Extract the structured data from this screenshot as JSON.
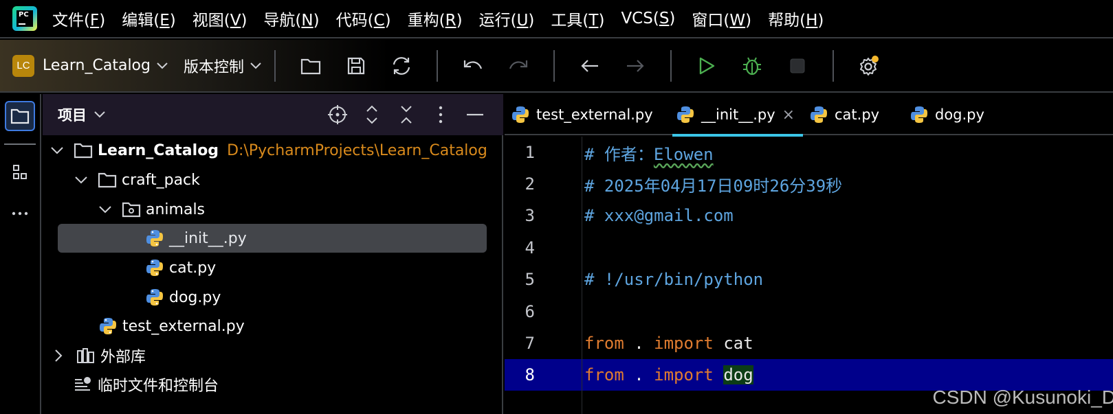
{
  "menu": [
    {
      "label": "文件(",
      "mn": "F",
      "end": ")"
    },
    {
      "label": "编辑(",
      "mn": "E",
      "end": ")"
    },
    {
      "label": "视图(",
      "mn": "V",
      "end": ")"
    },
    {
      "label": "导航(",
      "mn": "N",
      "end": ")"
    },
    {
      "label": "代码(",
      "mn": "C",
      "end": ")"
    },
    {
      "label": "重构(",
      "mn": "R",
      "end": ")"
    },
    {
      "label": "运行(",
      "mn": "U",
      "end": ")"
    },
    {
      "label": "工具(",
      "mn": "T",
      "end": ")"
    },
    {
      "label": "VCS(",
      "mn": "S",
      "end": ")"
    },
    {
      "label": "窗口(",
      "mn": "W",
      "end": ")"
    },
    {
      "label": "帮助(",
      "mn": "H",
      "end": ")"
    }
  ],
  "app_logo_text": "PC",
  "toolbar": {
    "project_badge": "LC",
    "project_name": "Learn_Catalog",
    "vcs_label": "版本控制"
  },
  "project_panel": {
    "title": "项目",
    "tree": [
      {
        "name": "Learn_Catalog",
        "hint": "D:\\PycharmProjects\\Learn_Catalog"
      },
      {
        "name": "craft_pack"
      },
      {
        "name": "animals"
      },
      {
        "name": "__init__.py"
      },
      {
        "name": "cat.py"
      },
      {
        "name": "dog.py"
      },
      {
        "name": "test_external.py"
      },
      {
        "name": "外部库"
      },
      {
        "name": "临时文件和控制台"
      }
    ]
  },
  "tabs": [
    {
      "label": "test_external.py"
    },
    {
      "label": "__init__.py",
      "close": "×"
    },
    {
      "label": "cat.py"
    },
    {
      "label": "dog.py"
    }
  ],
  "code": {
    "line_numbers": [
      "1",
      "2",
      "3",
      "4",
      "5",
      "6",
      "7",
      "8"
    ],
    "l1_prefix": "# 作者：",
    "l1_author": "Elowen",
    "l2": "# 2025年04月17日09时26分39秒",
    "l3": "# xxx@gmail.com",
    "l5": "# !/usr/bin/python",
    "kw_from": "from",
    "dot": " . ",
    "kw_import": "import",
    "l7_name": "cat",
    "l8_name": "dog"
  },
  "watermark": "CSDN @Kusunoki_D",
  "colors": {
    "accent": "#3bc5e7",
    "current_line": "#00008b",
    "comment": "#5ea5e0",
    "keyword": "#e07c30",
    "path_hint": "#d98a1c",
    "run": "#4caf50"
  }
}
